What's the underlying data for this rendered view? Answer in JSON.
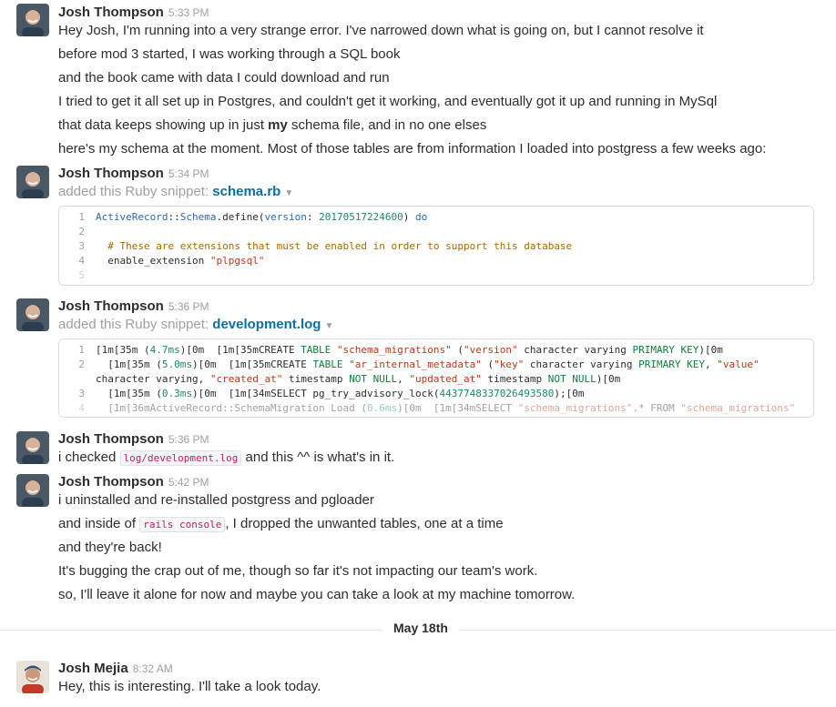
{
  "colors": {
    "link": "#0b6fa3",
    "muted": "#9e9ea6",
    "text": "#2c2d30",
    "code_pink": "#c41e56"
  },
  "messages": [
    {
      "author": "Josh Thompson",
      "time": "5:33 PM",
      "lines": [
        "Hey Josh, I'm running into a very strange error. I've narrowed down what is going on, but I cannot resolve it",
        "before mod 3 started, I was working through a SQL book",
        "and the book came with data I could download and run",
        "I tried to get it all set up in Postgres, and couldn't get it working, and eventually got it up and running in MySql",
        "that data keeps showing up in just ",
        "schema file, and in no one elses",
        "here's my schema at the moment. Most of those tables are from information I loaded into postgress a few weeks ago:"
      ],
      "bold_word": "my"
    },
    {
      "author": "Josh Thompson",
      "time": "5:34 PM",
      "meta_prefix": "added this Ruby snippet: ",
      "file": "schema.rb",
      "code": [
        {
          "n": "1",
          "t": "ActiveRecord::Schema.define(version: 20170517224600) do"
        },
        {
          "n": "2",
          "t": ""
        },
        {
          "n": "3",
          "t": "  # These are extensions that must be enabled in order to support this database"
        },
        {
          "n": "4",
          "t": "  enable_extension \"plpgsql\""
        },
        {
          "n": "5",
          "t": ""
        }
      ]
    },
    {
      "author": "Josh Thompson",
      "time": "5:36 PM",
      "meta_prefix": "added this Ruby snippet: ",
      "file": "development.log",
      "code": [
        {
          "n": "1",
          "t": "[1m[35m (4.7ms)[0m  [1m[35mCREATE TABLE \"schema_migrations\" (\"version\" character varying PRIMARY KEY)[0m"
        },
        {
          "n": "2",
          "t": "  [1m[35m (5.0ms)[0m  [1m[35mCREATE TABLE \"ar_internal_metadata\" (\"key\" character varying PRIMARY KEY, \"value\""
        },
        {
          "n": "",
          "t": "character varying, \"created_at\" timestamp NOT NULL, \"updated_at\" timestamp NOT NULL)[0m"
        },
        {
          "n": "3",
          "t": "  [1m[35m (0.3ms)[0m  [1m[34mSELECT pg_try_advisory_lock(4437748337026493580);[0m"
        },
        {
          "n": "4",
          "t": "  [1m[36mActiveRecord::SchemaMigration Load (0.6ms)[0m  [1m[34mSELECT \"schema_migrations\".* FROM \"schema_migrations\""
        }
      ]
    },
    {
      "author": "Josh Thompson",
      "time": "5:36 PM",
      "pre": "i checked ",
      "code_inline": "log/development.log",
      "post": " and this ^^ is what's in it."
    },
    {
      "author": "Josh Thompson",
      "time": "5:42 PM",
      "line1": "i uninstalled and re-installed postgress and pgloader",
      "line2_pre": "and inside of ",
      "line2_code": "rails console",
      "line2_post": ", I dropped the unwanted tables, one at a time",
      "line3": "and they're back!",
      "line4": "It's bugging the crap out of me, though so far it's not impacting our team's work.",
      "line5": "so, I'll leave it alone for now and maybe you can take a look at my machine tomorrow."
    }
  ],
  "divider": "May 18th",
  "reply": {
    "author": "Josh Mejia",
    "time": "8:32 AM",
    "text": "Hey, this is interesting. I'll take a look today."
  }
}
